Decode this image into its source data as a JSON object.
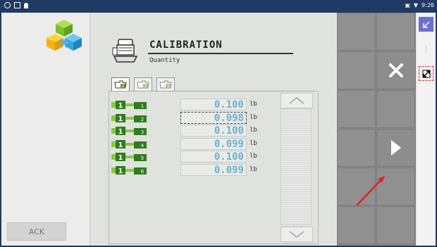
{
  "status_bar": {
    "left_icons": [
      "location-icon",
      "gallery-icon",
      "person-icon"
    ],
    "right_icons": [
      "nfc-icon",
      "wifi-icon"
    ],
    "time": "9:26"
  },
  "left_panel": {
    "ack_label": "ACK"
  },
  "header": {
    "title": "CALIBRATION",
    "subtitle": "Quantity"
  },
  "tabs": [
    {
      "label": "1",
      "active": true
    },
    {
      "label": "2",
      "active": false
    },
    {
      "label": "3",
      "active": false
    }
  ],
  "rows": [
    {
      "bin": "1",
      "section": "1",
      "value": "0.100",
      "unit": "lb",
      "selected": false
    },
    {
      "bin": "1",
      "section": "2",
      "value": "0.098",
      "unit": "lb",
      "selected": true
    },
    {
      "bin": "1",
      "section": "3",
      "value": "0.100",
      "unit": "lb",
      "selected": false
    },
    {
      "bin": "1",
      "section": "4",
      "value": "0.099",
      "unit": "lb",
      "selected": false
    },
    {
      "bin": "1",
      "section": "5",
      "value": "0.100",
      "unit": "lb",
      "selected": false
    },
    {
      "bin": "1",
      "section": "6",
      "value": "0.099",
      "unit": "lb",
      "selected": false
    }
  ],
  "right_grid": {
    "close_icon": "close-icon",
    "next_icon": "play-icon"
  },
  "far_right": {
    "icons": [
      "minimize-icon",
      "more-icon",
      "resize-icon"
    ]
  },
  "colors": {
    "value_text": "#6cb1d6",
    "status_bar": "#1f3a63",
    "accent_purple": "#6a6fd6",
    "annotation_arrow": "#e02020"
  }
}
